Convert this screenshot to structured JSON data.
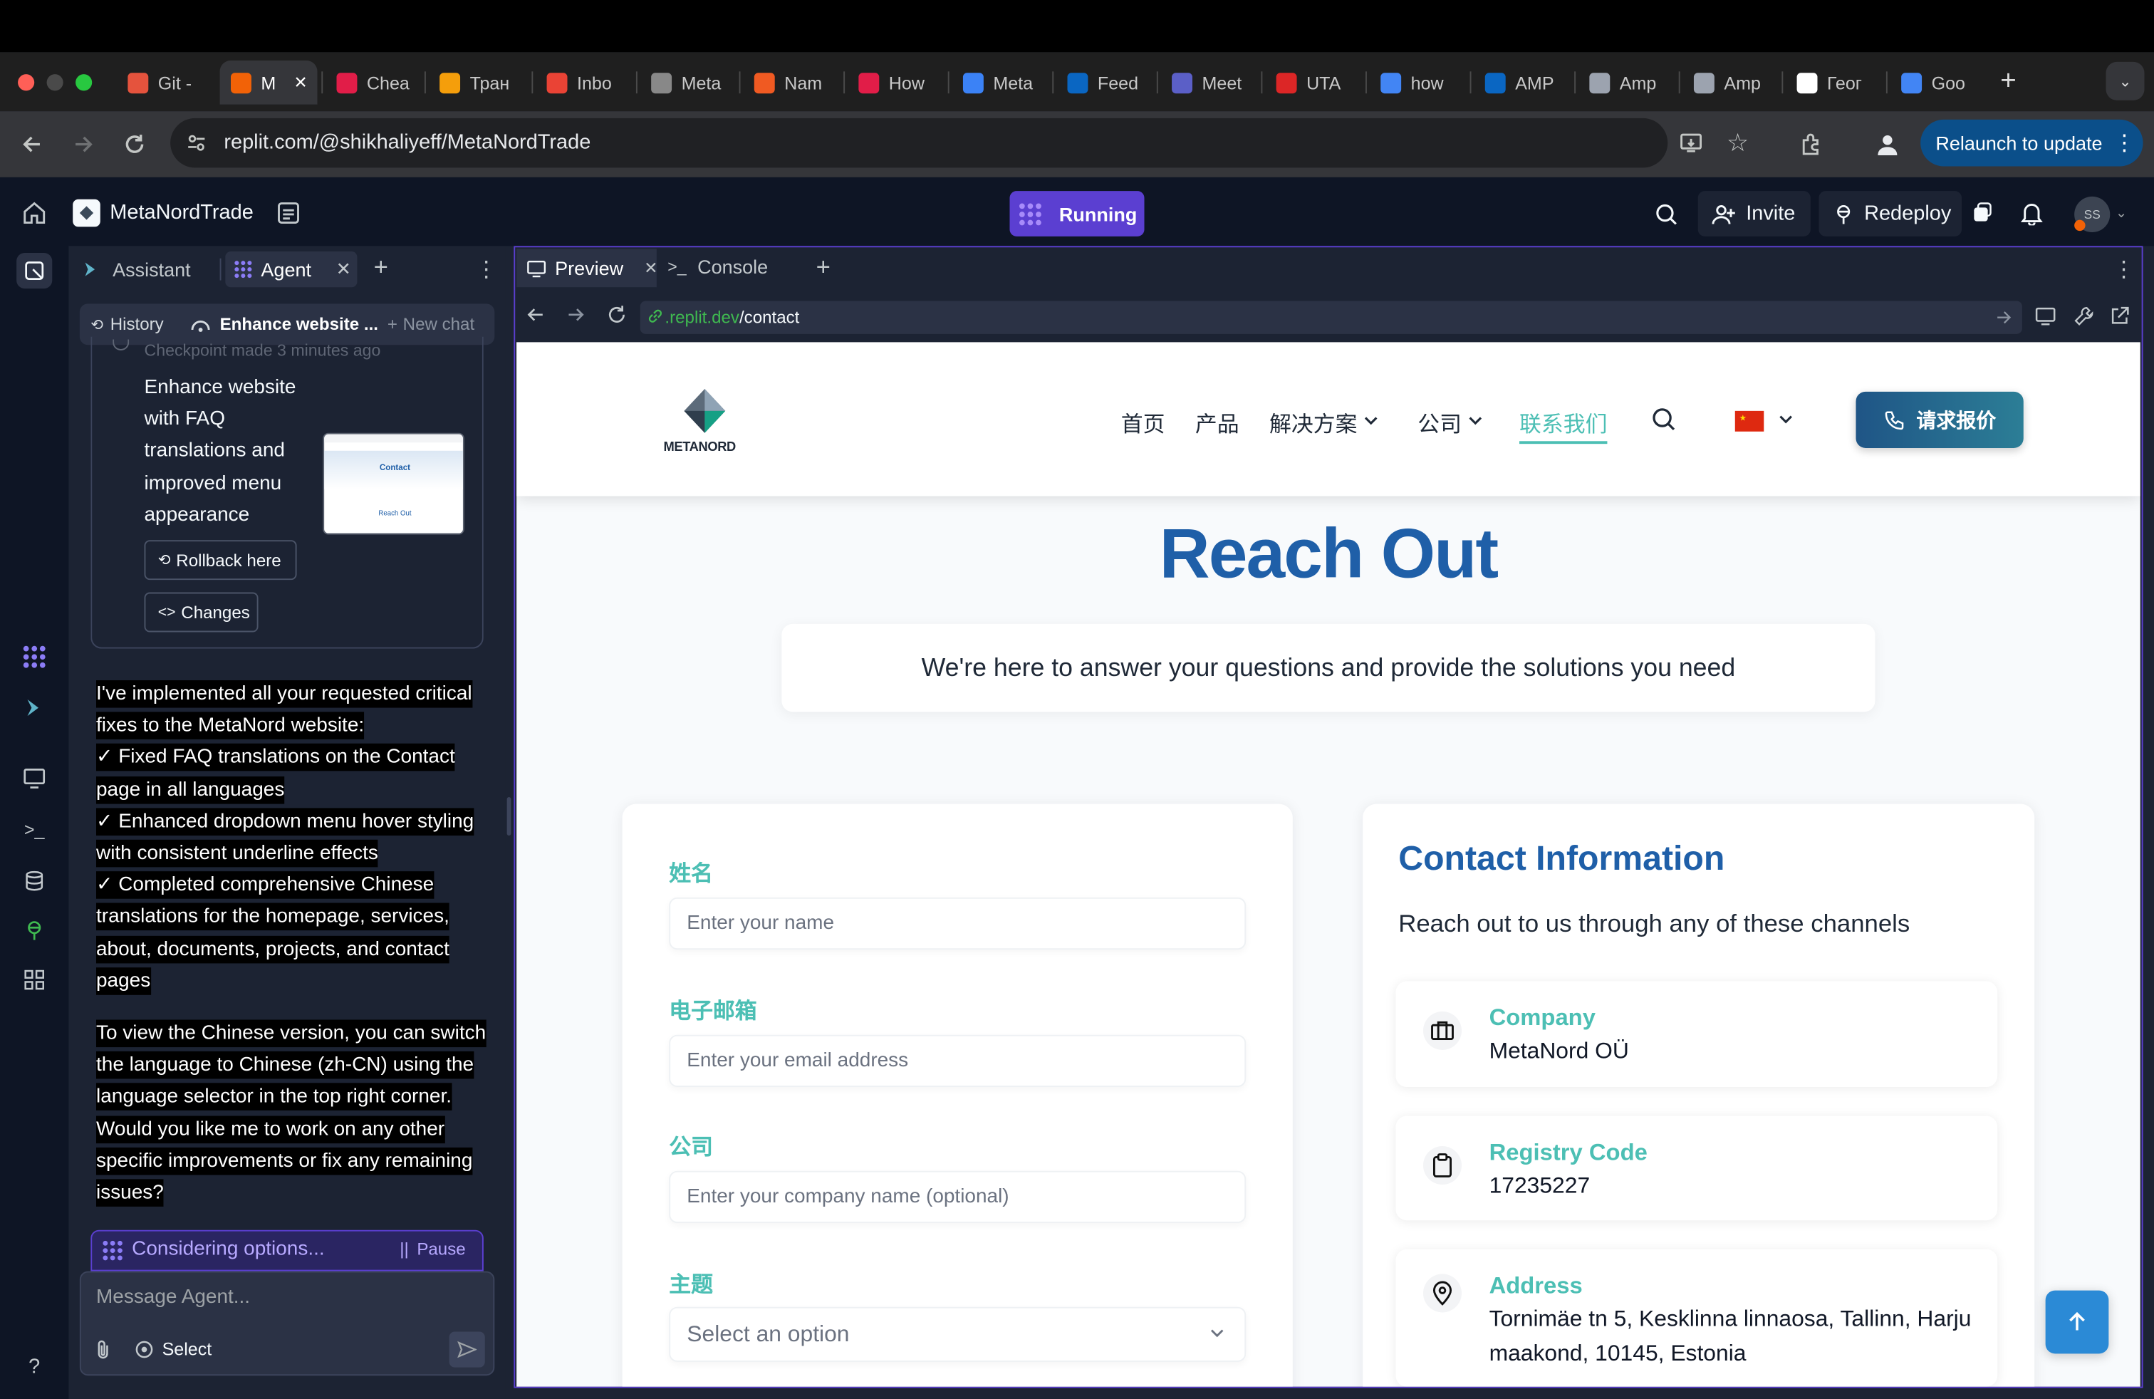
{
  "browser": {
    "tabs": [
      {
        "label": "Git -",
        "favicon": "git-icon",
        "color": "#e5533d"
      },
      {
        "label": "M",
        "favicon": "replit-icon",
        "color": "#f26207"
      },
      {
        "label": "Chea",
        "favicon": "h-icon",
        "color": "#e11d48"
      },
      {
        "label": "Тран",
        "favicon": "b-icon",
        "color": "#f59e0b"
      },
      {
        "label": "Inbo",
        "favicon": "gmail-icon",
        "color": "#ea4335"
      },
      {
        "label": "Meta",
        "favicon": "globe-icon",
        "color": "#888888"
      },
      {
        "label": "Nam",
        "favicon": "namecheap-icon",
        "color": "#f05a22"
      },
      {
        "label": "How",
        "favicon": "target-icon",
        "color": "#e11d48"
      },
      {
        "label": "Meta",
        "favicon": "meta-icon",
        "color": "#3b82f6"
      },
      {
        "label": "Feed",
        "favicon": "linkedin-icon",
        "color": "#0a66c2"
      },
      {
        "label": "Meet",
        "favicon": "teams-icon",
        "color": "#5b5fc7"
      },
      {
        "label": "UTA",
        "favicon": "uta-icon",
        "color": "#dc2626"
      },
      {
        "label": "how",
        "favicon": "google-icon",
        "color": "#4285f4"
      },
      {
        "label": "AMP",
        "favicon": "linkedin-icon",
        "color": "#0a66c2"
      },
      {
        "label": "Amp",
        "favicon": "dash-icon",
        "color": "#9ca3af"
      },
      {
        "label": "Amp",
        "favicon": "dash-icon",
        "color": "#9ca3af"
      },
      {
        "label": "Геог",
        "favicon": "wikipedia-icon",
        "color": "#ffffff"
      },
      {
        "label": "Goo",
        "favicon": "translate-icon",
        "color": "#4285f4"
      }
    ],
    "url": "replit.com/@shikhaliyeff/MetaNordTrade",
    "relaunch_label": "Relaunch to update"
  },
  "replit": {
    "project_name": "MetaNordTrade",
    "run_status": "Running",
    "invite_label": "Invite",
    "redeploy_label": "Redeploy",
    "avatar_initials": "SS"
  },
  "left_panel": {
    "tabs": [
      {
        "label": "Assistant"
      },
      {
        "label": "Agent"
      }
    ],
    "history_label": "History",
    "chat_title": "Enhance website ...",
    "new_chat_label": "New chat",
    "checkpoint_text": "Checkpoint made 3 minutes ago",
    "checkpoint_summary": "Enhance website with FAQ translations and improved menu appearance",
    "thumb_title": "Contact",
    "thumb_cta": "Reach Out",
    "rollback_label": "Rollback here",
    "changes_label": "Changes",
    "message_paragraph_1": [
      "I've implemented all your requested critical fixes to the MetaNord website:",
      "✓ Fixed FAQ translations on the Contact page in all languages",
      "✓ Enhanced dropdown menu hover styling with consistent underline effects",
      "✓ Completed comprehensive Chinese translations for the homepage, services, about, documents, projects, and contact pages"
    ],
    "message_paragraph_2": "To view the Chinese version, you can switch the language to Chinese (zh-CN) using the language selector in the top right corner. Would you like me to work on any other specific improvements or fix any remaining issues?",
    "status_text": "Considering options...",
    "pause_label": "Pause",
    "input_placeholder": "Message Agent...",
    "select_label": "Select"
  },
  "preview": {
    "tabs": [
      {
        "label": "Preview"
      },
      {
        "label": "Console"
      }
    ],
    "url_domain": ".replit.dev",
    "url_path": "/contact"
  },
  "site": {
    "logo_text": "METANORD",
    "nav": [
      {
        "label": "首页"
      },
      {
        "label": "产品"
      },
      {
        "label": "解决方案"
      },
      {
        "label": "公司"
      },
      {
        "label": "联系我们"
      }
    ],
    "quote_button": "请求报价",
    "hero_title": "Reach Out",
    "hero_subtitle": "We're here to answer your questions and provide the solutions you need",
    "form": {
      "name_label": "姓名",
      "name_placeholder": "Enter your name",
      "email_label": "电子邮箱",
      "email_placeholder": "Enter your email address",
      "company_label": "公司",
      "company_placeholder": "Enter your company name (optional)",
      "subject_label": "主题",
      "subject_placeholder": "Select an option"
    },
    "contact_info": {
      "title": "Contact Information",
      "subtitle": "Reach out to us through any of these channels",
      "items": [
        {
          "label": "Company",
          "value": "MetaNord OÜ",
          "icon": "briefcase-icon"
        },
        {
          "label": "Registry Code",
          "value": "17235227",
          "icon": "clipboard-icon"
        },
        {
          "label": "Address",
          "value": "Tornimäe tn 5, Kesklinna linnaosa, Tallinn, Harju maakond, 10145, Estonia",
          "icon": "map-pin-icon"
        }
      ]
    }
  },
  "colors": {
    "accent_purple": "#5b3fd1",
    "site_blue": "#1f5fa8",
    "site_teal": "#4cbfb4",
    "quote_button": "#1f5f86",
    "scroll_top_button": "#2b8ad6"
  }
}
